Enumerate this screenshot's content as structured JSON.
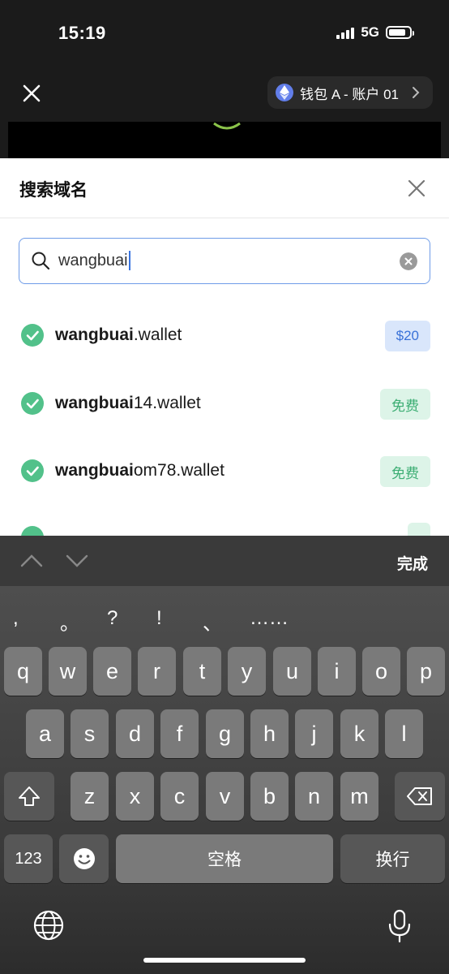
{
  "status": {
    "time": "15:19",
    "network": "5G"
  },
  "header": {
    "account_label": "钱包 A - 账户 01"
  },
  "sheet": {
    "title": "搜索域名",
    "search_value": "wangbuai",
    "results": [
      {
        "bold": "wangbuai",
        "suffix": ".wallet",
        "price": "$20",
        "price_type": "paid"
      },
      {
        "bold": "wangbuai",
        "suffix": "14.wallet",
        "price": "免费",
        "price_type": "free"
      },
      {
        "bold": "wangbuai",
        "suffix": "om78.wallet",
        "price": "免费",
        "price_type": "free"
      }
    ]
  },
  "keyboard": {
    "done_label": "完成",
    "punctuation": [
      ",",
      "。",
      "?",
      "!",
      "、",
      "……"
    ],
    "row1": [
      "q",
      "w",
      "e",
      "r",
      "t",
      "y",
      "u",
      "i",
      "o",
      "p"
    ],
    "row2": [
      "a",
      "s",
      "d",
      "f",
      "g",
      "h",
      "j",
      "k",
      "l"
    ],
    "row3": [
      "z",
      "x",
      "c",
      "v",
      "b",
      "n",
      "m"
    ],
    "numbers_label": "123",
    "space_label": "空格",
    "return_label": "换行"
  }
}
